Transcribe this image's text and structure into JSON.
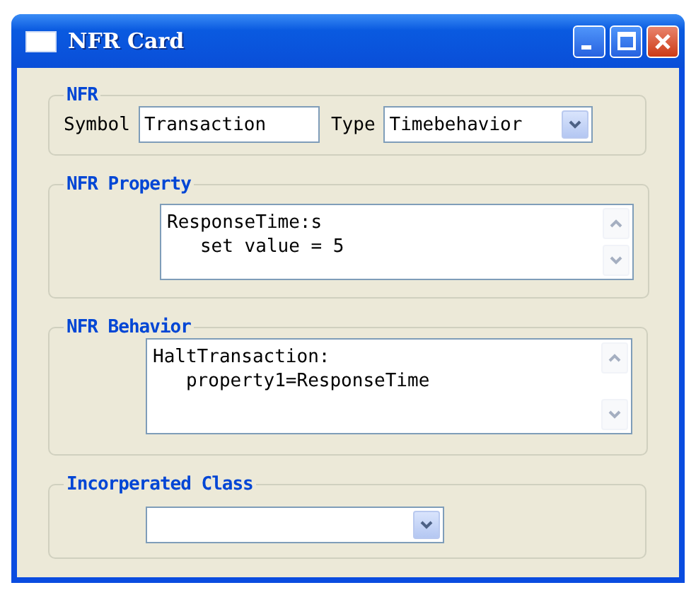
{
  "window": {
    "title": "NFR Card",
    "buttons": [
      {
        "kind": "minimize"
      },
      {
        "kind": "maximize"
      },
      {
        "kind": "close"
      }
    ]
  },
  "nfr": {
    "legend": "NFR",
    "symbol_label": "Symbol",
    "symbol_value": "Transaction",
    "type_label": "Type",
    "type_value": "Timebehavior"
  },
  "property": {
    "legend": "NFR Property",
    "lines": [
      "ResponseTime:s",
      "   set value = 5"
    ]
  },
  "behavior": {
    "legend": "NFR Behavior",
    "lines": [
      "HaltTransaction:",
      "   property1=ResponseTime"
    ]
  },
  "incorporated_class": {
    "legend": "Incorperated Class"
  }
}
